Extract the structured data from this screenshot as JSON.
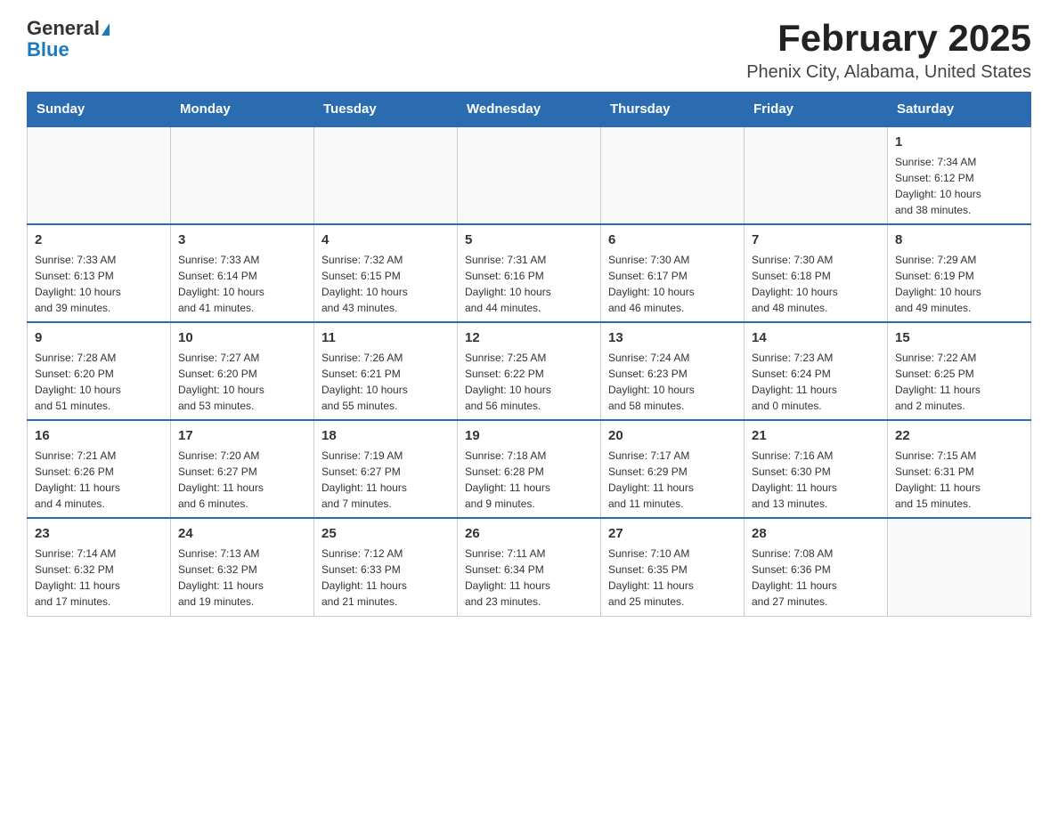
{
  "logo": {
    "general": "General",
    "blue": "Blue"
  },
  "title": "February 2025",
  "subtitle": "Phenix City, Alabama, United States",
  "weekdays": [
    "Sunday",
    "Monday",
    "Tuesday",
    "Wednesday",
    "Thursday",
    "Friday",
    "Saturday"
  ],
  "weeks": [
    [
      {
        "day": "",
        "info": ""
      },
      {
        "day": "",
        "info": ""
      },
      {
        "day": "",
        "info": ""
      },
      {
        "day": "",
        "info": ""
      },
      {
        "day": "",
        "info": ""
      },
      {
        "day": "",
        "info": ""
      },
      {
        "day": "1",
        "info": "Sunrise: 7:34 AM\nSunset: 6:12 PM\nDaylight: 10 hours\nand 38 minutes."
      }
    ],
    [
      {
        "day": "2",
        "info": "Sunrise: 7:33 AM\nSunset: 6:13 PM\nDaylight: 10 hours\nand 39 minutes."
      },
      {
        "day": "3",
        "info": "Sunrise: 7:33 AM\nSunset: 6:14 PM\nDaylight: 10 hours\nand 41 minutes."
      },
      {
        "day": "4",
        "info": "Sunrise: 7:32 AM\nSunset: 6:15 PM\nDaylight: 10 hours\nand 43 minutes."
      },
      {
        "day": "5",
        "info": "Sunrise: 7:31 AM\nSunset: 6:16 PM\nDaylight: 10 hours\nand 44 minutes."
      },
      {
        "day": "6",
        "info": "Sunrise: 7:30 AM\nSunset: 6:17 PM\nDaylight: 10 hours\nand 46 minutes."
      },
      {
        "day": "7",
        "info": "Sunrise: 7:30 AM\nSunset: 6:18 PM\nDaylight: 10 hours\nand 48 minutes."
      },
      {
        "day": "8",
        "info": "Sunrise: 7:29 AM\nSunset: 6:19 PM\nDaylight: 10 hours\nand 49 minutes."
      }
    ],
    [
      {
        "day": "9",
        "info": "Sunrise: 7:28 AM\nSunset: 6:20 PM\nDaylight: 10 hours\nand 51 minutes."
      },
      {
        "day": "10",
        "info": "Sunrise: 7:27 AM\nSunset: 6:20 PM\nDaylight: 10 hours\nand 53 minutes."
      },
      {
        "day": "11",
        "info": "Sunrise: 7:26 AM\nSunset: 6:21 PM\nDaylight: 10 hours\nand 55 minutes."
      },
      {
        "day": "12",
        "info": "Sunrise: 7:25 AM\nSunset: 6:22 PM\nDaylight: 10 hours\nand 56 minutes."
      },
      {
        "day": "13",
        "info": "Sunrise: 7:24 AM\nSunset: 6:23 PM\nDaylight: 10 hours\nand 58 minutes."
      },
      {
        "day": "14",
        "info": "Sunrise: 7:23 AM\nSunset: 6:24 PM\nDaylight: 11 hours\nand 0 minutes."
      },
      {
        "day": "15",
        "info": "Sunrise: 7:22 AM\nSunset: 6:25 PM\nDaylight: 11 hours\nand 2 minutes."
      }
    ],
    [
      {
        "day": "16",
        "info": "Sunrise: 7:21 AM\nSunset: 6:26 PM\nDaylight: 11 hours\nand 4 minutes."
      },
      {
        "day": "17",
        "info": "Sunrise: 7:20 AM\nSunset: 6:27 PM\nDaylight: 11 hours\nand 6 minutes."
      },
      {
        "day": "18",
        "info": "Sunrise: 7:19 AM\nSunset: 6:27 PM\nDaylight: 11 hours\nand 7 minutes."
      },
      {
        "day": "19",
        "info": "Sunrise: 7:18 AM\nSunset: 6:28 PM\nDaylight: 11 hours\nand 9 minutes."
      },
      {
        "day": "20",
        "info": "Sunrise: 7:17 AM\nSunset: 6:29 PM\nDaylight: 11 hours\nand 11 minutes."
      },
      {
        "day": "21",
        "info": "Sunrise: 7:16 AM\nSunset: 6:30 PM\nDaylight: 11 hours\nand 13 minutes."
      },
      {
        "day": "22",
        "info": "Sunrise: 7:15 AM\nSunset: 6:31 PM\nDaylight: 11 hours\nand 15 minutes."
      }
    ],
    [
      {
        "day": "23",
        "info": "Sunrise: 7:14 AM\nSunset: 6:32 PM\nDaylight: 11 hours\nand 17 minutes."
      },
      {
        "day": "24",
        "info": "Sunrise: 7:13 AM\nSunset: 6:32 PM\nDaylight: 11 hours\nand 19 minutes."
      },
      {
        "day": "25",
        "info": "Sunrise: 7:12 AM\nSunset: 6:33 PM\nDaylight: 11 hours\nand 21 minutes."
      },
      {
        "day": "26",
        "info": "Sunrise: 7:11 AM\nSunset: 6:34 PM\nDaylight: 11 hours\nand 23 minutes."
      },
      {
        "day": "27",
        "info": "Sunrise: 7:10 AM\nSunset: 6:35 PM\nDaylight: 11 hours\nand 25 minutes."
      },
      {
        "day": "28",
        "info": "Sunrise: 7:08 AM\nSunset: 6:36 PM\nDaylight: 11 hours\nand 27 minutes."
      },
      {
        "day": "",
        "info": ""
      }
    ]
  ]
}
